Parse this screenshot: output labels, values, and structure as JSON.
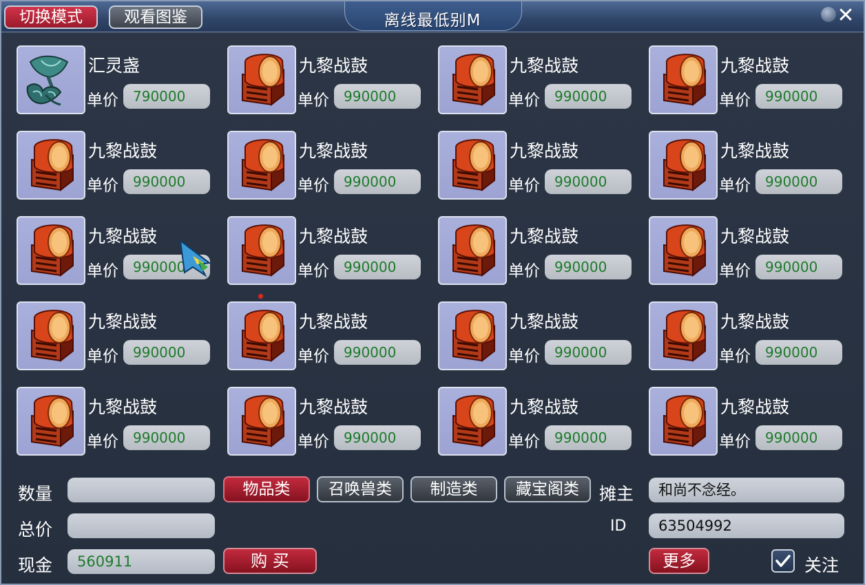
{
  "header": {
    "title": "离线最低别M",
    "switch_mode_label": "切换模式",
    "view_atlas_label": "观看图鉴",
    "close_label": "✕"
  },
  "price_label": "单价",
  "items": [
    {
      "name": "汇灵盏",
      "price": "790000",
      "icon": "spirit-lotus-icon"
    },
    {
      "name": "九黎战鼓",
      "price": "990000",
      "icon": "war-drum-icon"
    },
    {
      "name": "九黎战鼓",
      "price": "990000",
      "icon": "war-drum-icon"
    },
    {
      "name": "九黎战鼓",
      "price": "990000",
      "icon": "war-drum-icon"
    },
    {
      "name": "九黎战鼓",
      "price": "990000",
      "icon": "war-drum-icon"
    },
    {
      "name": "九黎战鼓",
      "price": "990000",
      "icon": "war-drum-icon"
    },
    {
      "name": "九黎战鼓",
      "price": "990000",
      "icon": "war-drum-icon"
    },
    {
      "name": "九黎战鼓",
      "price": "990000",
      "icon": "war-drum-icon"
    },
    {
      "name": "九黎战鼓",
      "price": "990000",
      "icon": "war-drum-icon"
    },
    {
      "name": "九黎战鼓",
      "price": "990000",
      "icon": "war-drum-icon"
    },
    {
      "name": "九黎战鼓",
      "price": "990000",
      "icon": "war-drum-icon"
    },
    {
      "name": "九黎战鼓",
      "price": "990000",
      "icon": "war-drum-icon"
    },
    {
      "name": "九黎战鼓",
      "price": "990000",
      "icon": "war-drum-icon"
    },
    {
      "name": "九黎战鼓",
      "price": "990000",
      "icon": "war-drum-icon"
    },
    {
      "name": "九黎战鼓",
      "price": "990000",
      "icon": "war-drum-icon"
    },
    {
      "name": "九黎战鼓",
      "price": "990000",
      "icon": "war-drum-icon"
    },
    {
      "name": "九黎战鼓",
      "price": "990000",
      "icon": "war-drum-icon"
    },
    {
      "name": "九黎战鼓",
      "price": "990000",
      "icon": "war-drum-icon"
    },
    {
      "name": "九黎战鼓",
      "price": "990000",
      "icon": "war-drum-icon"
    },
    {
      "name": "九黎战鼓",
      "price": "990000",
      "icon": "war-drum-icon"
    }
  ],
  "footer": {
    "quantity_label": "数量",
    "quantity_value": "",
    "total_label": "总价",
    "total_value": "",
    "cash_label": "现金",
    "cash_value": "560911",
    "buy_label": "购 买",
    "categories": [
      {
        "label": "物品类",
        "active": true
      },
      {
        "label": "召唤兽类",
        "active": false
      },
      {
        "label": "制造类",
        "active": false
      },
      {
        "label": "藏宝阁类",
        "active": false
      }
    ],
    "seller_label": "摊主",
    "seller_name": "和尚不念经。",
    "id_label": "ID",
    "id_value": "63504992",
    "more_label": "更多",
    "follow_label": "关注",
    "follow_checked": true
  },
  "colors": {
    "accent_red": "#a81e30",
    "price_green": "#1d7a2a",
    "slot_bg": "#a4aad8"
  }
}
